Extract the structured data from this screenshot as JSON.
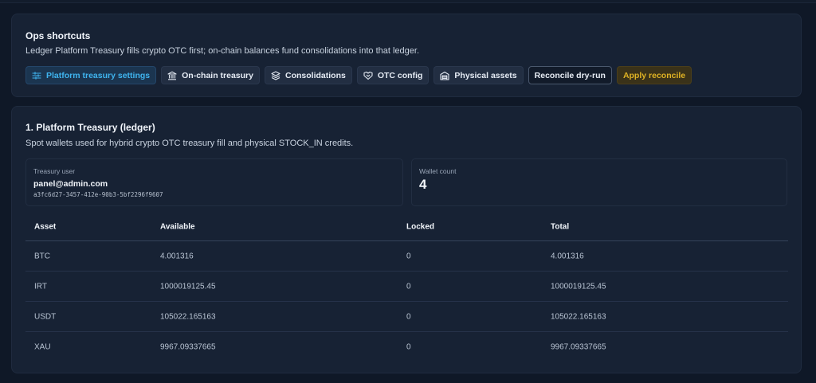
{
  "ops": {
    "title": "Ops shortcuts",
    "subtitle": "Ledger Platform Treasury fills crypto OTC first; on-chain balances fund consolidations into that ledger.",
    "shortcuts": [
      {
        "label": "Platform treasury settings",
        "icon": "sliders-icon",
        "state": "active"
      },
      {
        "label": "On-chain treasury",
        "icon": "bank-icon"
      },
      {
        "label": "Consolidations",
        "icon": "layers-icon"
      },
      {
        "label": "OTC config",
        "icon": "handshake-icon"
      },
      {
        "label": "Physical assets",
        "icon": "warehouse-icon"
      },
      {
        "label": "Reconcile dry-run",
        "icon": null,
        "state": "outline"
      },
      {
        "label": "Apply reconcile",
        "icon": null,
        "state": "warning"
      }
    ]
  },
  "treasury": {
    "title": "1. Platform Treasury (ledger)",
    "subtitle": "Spot wallets used for hybrid crypto OTC treasury fill and physical STOCK_IN credits.",
    "user_label": "Treasury user",
    "user_email": "panel@admin.com",
    "user_id": "a3fc6d27-3457-412e-90b3-5bf2296f9607",
    "wallet_count_label": "Wallet count",
    "wallet_count": "4",
    "columns": [
      "Asset",
      "Available",
      "Locked",
      "Total"
    ],
    "rows": [
      [
        "BTC",
        "4.001316",
        "0",
        "4.001316"
      ],
      [
        "IRT",
        "1000019125.45",
        "0",
        "1000019125.45"
      ],
      [
        "USDT",
        "105022.165163",
        "0",
        "105022.165163"
      ],
      [
        "XAU",
        "9967.09337665",
        "0",
        "9967.09337665"
      ]
    ]
  },
  "colors": {
    "background": "#0f1827",
    "card": "#172234",
    "accent": "#3fb4ef",
    "warning": "#e0b324"
  }
}
